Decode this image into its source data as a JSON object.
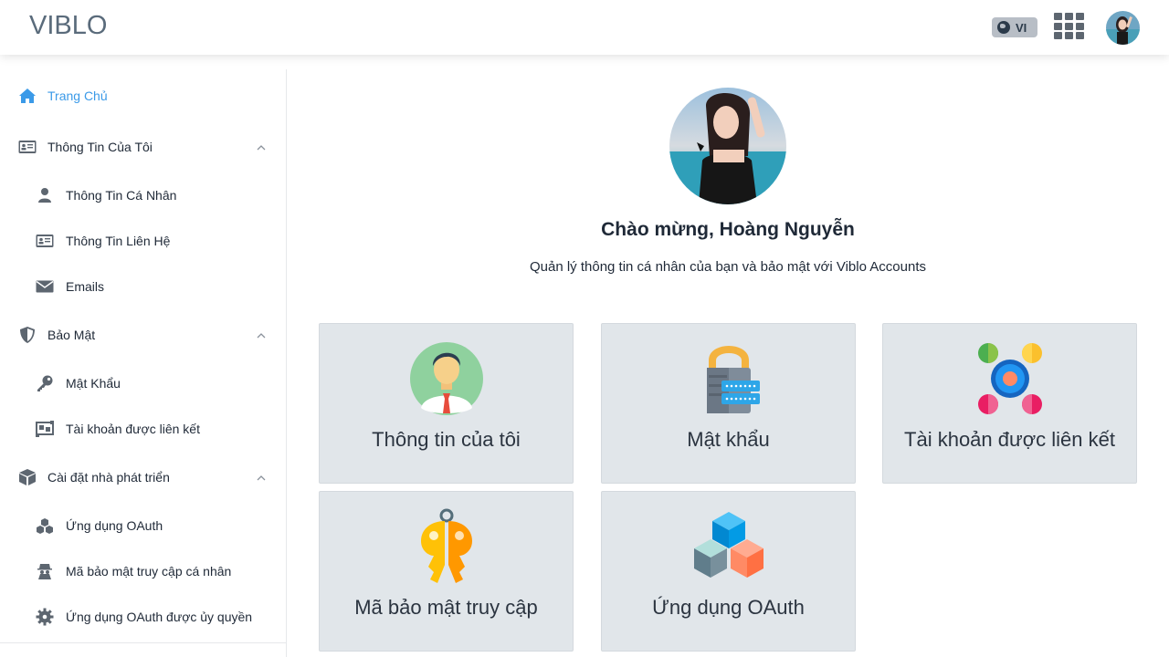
{
  "header": {
    "logo_text": "VIBLO",
    "lang_label": "VI",
    "icons": [
      "globe-icon",
      "apps-grid-icon",
      "user-avatar"
    ]
  },
  "sidebar": {
    "items": [
      {
        "label": "Trang Chủ",
        "icon": "home-icon",
        "active": true
      },
      {
        "label": "Thông Tin Của Tôi",
        "icon": "id-card-icon"
      },
      {
        "label": "Thông Tin Cá Nhân",
        "icon": "user-icon"
      },
      {
        "label": "Thông Tin Liên Hệ",
        "icon": "contact-card-icon"
      },
      {
        "label": "Emails",
        "icon": "envelope-icon"
      },
      {
        "label": "Bảo Mật",
        "icon": "shield-icon"
      },
      {
        "label": "Mật Khẩu",
        "icon": "key-icon"
      },
      {
        "label": "Tài khoản được liên kết",
        "icon": "linked-account-icon"
      },
      {
        "label": "Cài đặt nhà phát triển",
        "icon": "box-icon"
      },
      {
        "label": "Ứng dụng OAuth",
        "icon": "cubes-icon"
      },
      {
        "label": "Mã bảo mật truy cập cá nhân",
        "icon": "user-secret-icon"
      },
      {
        "label": "Ứng dụng OAuth được ủy quyền",
        "icon": "gear-icon"
      }
    ]
  },
  "main": {
    "welcome": "Chào mừng, Hoàng Nguyễn",
    "subtitle": "Quản lý thông tin cá nhân của bạn và bảo mật với Viblo Accounts",
    "cards": [
      {
        "label": "Thông tin của tôi",
        "icon": "person-avatar-icon"
      },
      {
        "label": "Mật khẩu",
        "icon": "padlock-icon"
      },
      {
        "label": "Tài khoản được liên kết",
        "icon": "connected-nodes-icon"
      },
      {
        "label": "Mã bảo mật truy cập",
        "icon": "keys-icon"
      },
      {
        "label": "Ứng dụng OAuth",
        "icon": "blocks-icon"
      }
    ]
  },
  "colors": {
    "accent": "#3b9ae8",
    "card_bg": "#e1e6ea",
    "text": "#1f2937"
  }
}
